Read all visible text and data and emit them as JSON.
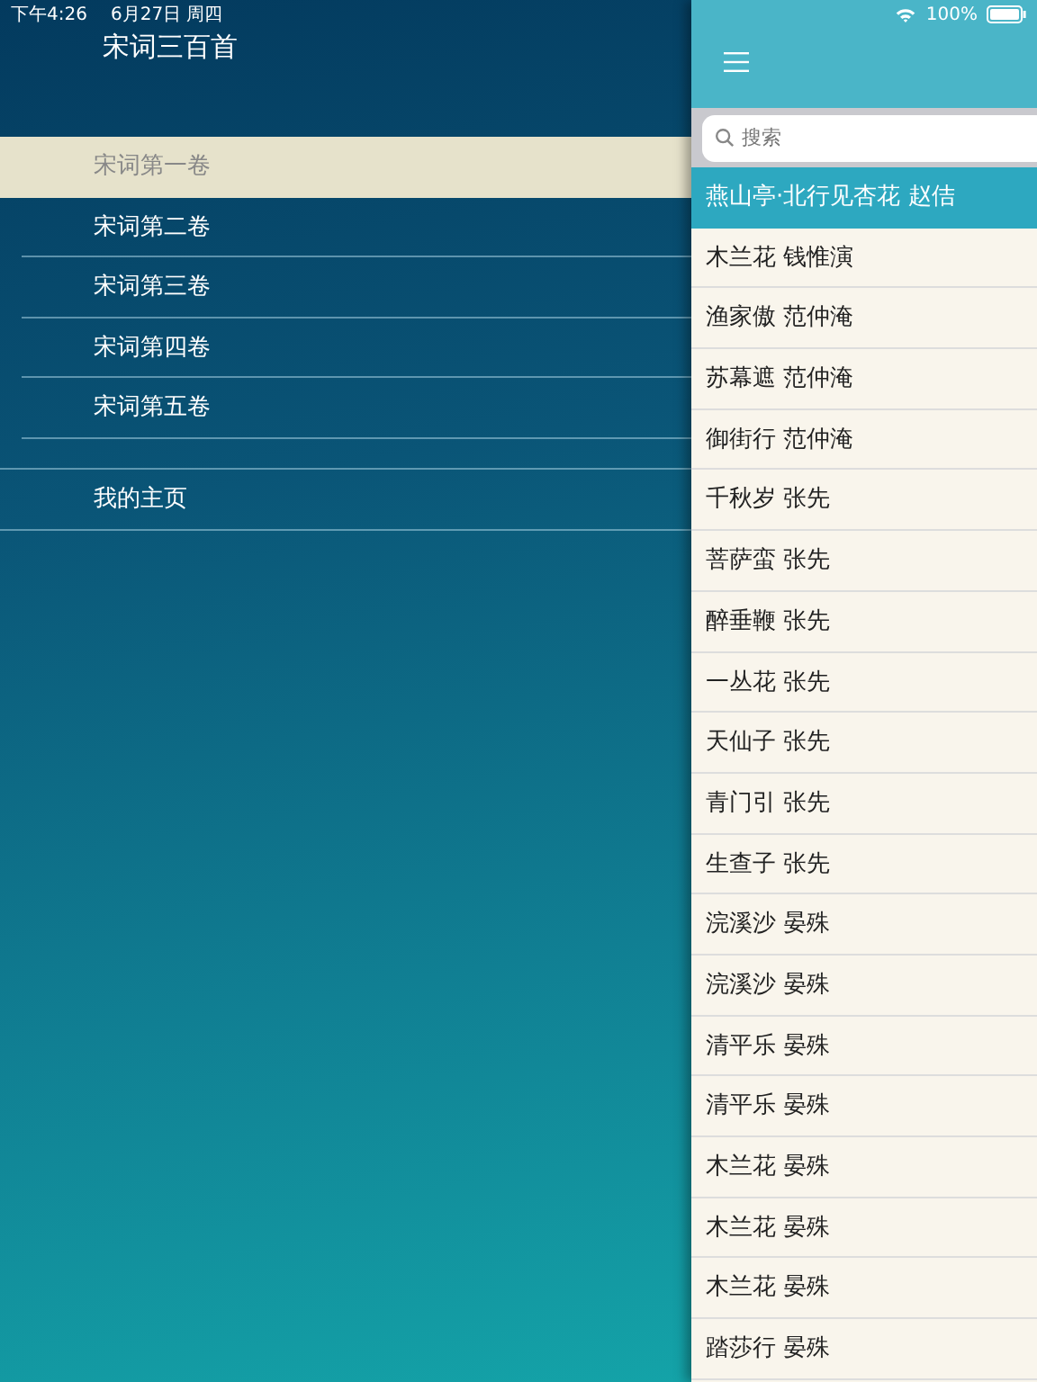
{
  "status_bar": {
    "time": "下午4:26",
    "date": "6月27日 周四",
    "battery": "100%"
  },
  "sidebar": {
    "title": "宋词三百首",
    "items": [
      {
        "label": "宋词第一卷",
        "selected": true,
        "kind": "item"
      },
      {
        "label": "宋词第二卷",
        "selected": false,
        "kind": "item"
      },
      {
        "label": "宋词第三卷",
        "selected": false,
        "kind": "item"
      },
      {
        "label": "宋词第四卷",
        "selected": false,
        "kind": "item"
      },
      {
        "label": "宋词第五卷",
        "selected": false,
        "kind": "item"
      },
      {
        "kind": "spacer"
      },
      {
        "label": "我的主页",
        "selected": false,
        "kind": "item"
      }
    ]
  },
  "list_panel": {
    "search": {
      "placeholder": "搜索"
    },
    "items": [
      {
        "label": "燕山亭·北行见杏花 赵佶",
        "selected": true
      },
      {
        "label": "木兰花 钱惟演",
        "selected": false
      },
      {
        "label": "渔家傲 范仲淹",
        "selected": false
      },
      {
        "label": "苏幕遮 范仲淹",
        "selected": false
      },
      {
        "label": "御街行 范仲淹",
        "selected": false
      },
      {
        "label": "千秋岁 张先",
        "selected": false
      },
      {
        "label": "菩萨蛮 张先",
        "selected": false
      },
      {
        "label": "醉垂鞭 张先",
        "selected": false
      },
      {
        "label": "一丛花 张先",
        "selected": false
      },
      {
        "label": "天仙子 张先",
        "selected": false
      },
      {
        "label": "青门引 张先",
        "selected": false
      },
      {
        "label": "生查子 张先",
        "selected": false
      },
      {
        "label": "浣溪沙 晏殊",
        "selected": false
      },
      {
        "label": "浣溪沙 晏殊",
        "selected": false
      },
      {
        "label": "清平乐 晏殊",
        "selected": false
      },
      {
        "label": "清平乐 晏殊",
        "selected": false
      },
      {
        "label": "木兰花 晏殊",
        "selected": false
      },
      {
        "label": "木兰花 晏殊",
        "selected": false
      },
      {
        "label": "木兰花 晏殊",
        "selected": false
      },
      {
        "label": "踏莎行 晏殊",
        "selected": false
      }
    ]
  }
}
